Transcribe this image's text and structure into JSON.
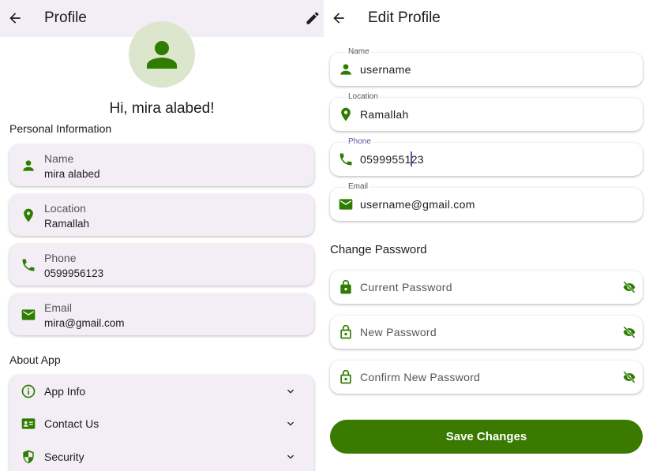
{
  "colors": {
    "accent": "#3a7a00",
    "icon_green": "#2e7d00",
    "card_bg": "#f3eef5",
    "focus": "#6750a4"
  },
  "profile": {
    "appbar": {
      "title": "Profile",
      "back_icon": "arrow-left-icon",
      "edit_icon": "pencil-icon"
    },
    "greeting": "Hi, mira alabed!",
    "personal_section": "Personal Information",
    "cards": [
      {
        "icon": "person-icon",
        "label": "Name",
        "value": "mira alabed"
      },
      {
        "icon": "location-pin-icon",
        "label": "Location",
        "value": "Ramallah"
      },
      {
        "icon": "phone-icon",
        "label": "Phone",
        "value": "0599956123"
      },
      {
        "icon": "email-icon",
        "label": "Email",
        "value": "mira@gmail.com"
      }
    ],
    "about_section": "About App",
    "about_items": [
      {
        "icon": "info-icon",
        "label": "App Info"
      },
      {
        "icon": "contact-card-icon",
        "label": "Contact Us"
      },
      {
        "icon": "shield-icon",
        "label": "Security"
      }
    ]
  },
  "edit": {
    "appbar": {
      "title": "Edit Profile",
      "back_icon": "arrow-left-icon"
    },
    "fields": [
      {
        "icon": "person-icon",
        "label": "Name",
        "value": "username"
      },
      {
        "icon": "location-pin-icon",
        "label": "Location",
        "value": "Ramallah"
      },
      {
        "icon": "phone-icon",
        "label": "Phone",
        "value": "0599955123",
        "focused": true
      },
      {
        "icon": "email-icon",
        "label": "Email",
        "value": "username@gmail.com"
      }
    ],
    "change_password_title": "Change Password",
    "password_fields": [
      {
        "icon": "lock-filled-icon",
        "placeholder": "Current Password"
      },
      {
        "icon": "lock-open-outline-icon",
        "placeholder": "New Password"
      },
      {
        "icon": "lock-open-outline-icon",
        "placeholder": "Confirm New Password"
      }
    ],
    "save_label": "Save Changes"
  }
}
